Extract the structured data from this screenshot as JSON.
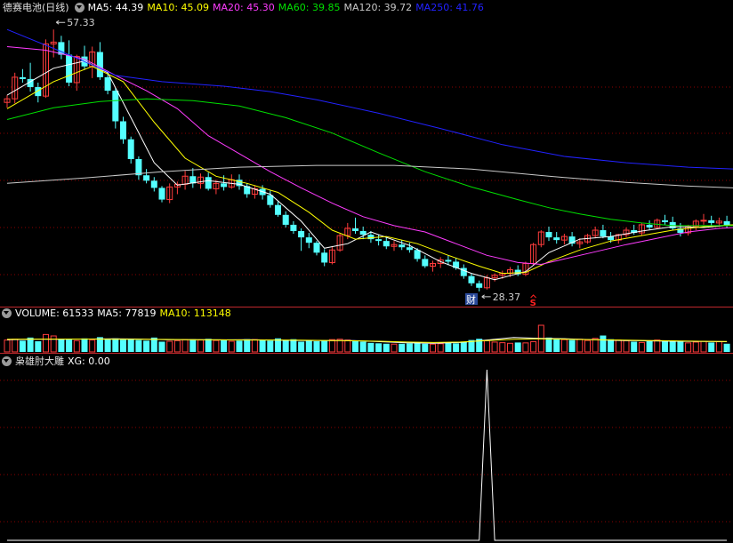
{
  "price_panel": {
    "stock_name": "德赛电池",
    "period": "(日线)",
    "ma_labels": [
      {
        "text": "MA5: 44.39",
        "color": "#ffffff"
      },
      {
        "text": "MA10: 45.09",
        "color": "#ffff00"
      },
      {
        "text": "MA20: 45.30",
        "color": "#ff3cff"
      },
      {
        "text": "MA60: 39.85",
        "color": "#00e000"
      },
      {
        "text": "MA120: 39.72",
        "color": "#c8c8c8"
      },
      {
        "text": "MA250: 41.76",
        "color": "#2222ff"
      }
    ],
    "high_marker": "57.33",
    "low_marker": "28.37",
    "event_badge": "财",
    "signal_mark": "S"
  },
  "volume_panel": {
    "labels": [
      {
        "text": "VOLUME: 61533",
        "color": "#ffffff"
      },
      {
        "text": "MA5: 77819",
        "color": "#ffffff"
      },
      {
        "text": "MA10: 113148",
        "color": "#ffff00"
      }
    ]
  },
  "indicator_panel": {
    "name": "枭雄肘大雕",
    "xg_label": "XG: 0.00"
  },
  "colors": {
    "up": "#ff3c3c",
    "down": "#54ffff",
    "grid": "#8b0000",
    "separator": "#c0282d",
    "background": "#000000"
  },
  "chart_data": {
    "type": "candlestick",
    "y_range": [
      27,
      59
    ],
    "ohlc": [
      [
        49.2,
        50.0,
        48.6,
        49.6
      ],
      [
        49.6,
        52.5,
        49.1,
        52.0
      ],
      [
        52.0,
        52.9,
        51.4,
        51.8
      ],
      [
        51.8,
        53.6,
        50.4,
        50.9
      ],
      [
        50.9,
        51.4,
        49.2,
        49.9
      ],
      [
        49.9,
        56.2,
        49.7,
        55.7
      ],
      [
        55.7,
        57.3,
        54.2,
        55.9
      ],
      [
        55.9,
        56.6,
        54.0,
        54.5
      ],
      [
        54.5,
        56.1,
        51.0,
        51.4
      ],
      [
        51.4,
        54.5,
        50.5,
        54.3
      ],
      [
        54.3,
        55.5,
        52.8,
        53.2
      ],
      [
        53.2,
        55.4,
        51.9,
        54.8
      ],
      [
        54.8,
        55.9,
        51.7,
        52.0
      ],
      [
        52.0,
        52.7,
        50.1,
        50.5
      ],
      [
        50.5,
        50.8,
        46.3,
        47.1
      ],
      [
        47.1,
        47.6,
        44.6,
        45.1
      ],
      [
        45.1,
        45.4,
        42.4,
        42.9
      ],
      [
        42.9,
        43.2,
        40.6,
        41.1
      ],
      [
        41.1,
        41.8,
        40.2,
        40.5
      ],
      [
        40.5,
        40.9,
        39.3,
        39.7
      ],
      [
        39.7,
        39.9,
        38.1,
        38.4
      ],
      [
        38.4,
        40.2,
        38.0,
        39.8
      ],
      [
        39.8,
        40.4,
        39.0,
        40.1
      ],
      [
        40.1,
        41.6,
        39.5,
        41.0
      ],
      [
        41.0,
        41.9,
        39.7,
        40.2
      ],
      [
        40.2,
        41.3,
        39.6,
        40.9
      ],
      [
        40.9,
        41.4,
        39.4,
        39.6
      ],
      [
        39.6,
        40.6,
        39.0,
        40.2
      ],
      [
        40.2,
        41.1,
        39.4,
        39.8
      ],
      [
        39.8,
        41.2,
        39.6,
        40.6
      ],
      [
        40.6,
        41.2,
        39.5,
        39.9
      ],
      [
        39.9,
        40.2,
        38.6,
        39.0
      ],
      [
        39.0,
        40.0,
        38.5,
        39.6
      ],
      [
        39.6,
        40.0,
        38.4,
        38.9
      ],
      [
        38.9,
        39.4,
        37.5,
        37.8
      ],
      [
        37.8,
        38.2,
        36.5,
        36.7
      ],
      [
        36.7,
        37.1,
        35.3,
        35.6
      ],
      [
        35.6,
        36.0,
        34.6,
        34.9
      ],
      [
        34.9,
        35.2,
        32.7,
        34.2
      ],
      [
        34.2,
        34.7,
        33.0,
        33.6
      ],
      [
        33.6,
        33.8,
        32.2,
        32.5
      ],
      [
        32.5,
        32.9,
        31.0,
        31.4
      ],
      [
        31.4,
        33.2,
        31.2,
        32.8
      ],
      [
        32.8,
        34.6,
        32.6,
        34.4
      ],
      [
        34.4,
        35.8,
        34.0,
        35.2
      ],
      [
        35.2,
        36.4,
        34.6,
        34.9
      ],
      [
        34.9,
        35.4,
        34.0,
        34.5
      ],
      [
        34.5,
        34.9,
        33.6,
        34.0
      ],
      [
        34.0,
        34.5,
        33.3,
        33.8
      ],
      [
        33.8,
        34.3,
        32.9,
        33.2
      ],
      [
        33.2,
        33.8,
        32.7,
        33.4
      ],
      [
        33.4,
        33.9,
        32.8,
        33.1
      ],
      [
        33.1,
        33.6,
        32.5,
        32.8
      ],
      [
        32.8,
        33.0,
        31.5,
        31.8
      ],
      [
        31.8,
        32.2,
        30.8,
        31.0
      ],
      [
        31.0,
        31.6,
        30.4,
        31.3
      ],
      [
        31.3,
        32.0,
        30.8,
        31.7
      ],
      [
        31.7,
        32.2,
        31.1,
        31.5
      ],
      [
        31.5,
        31.9,
        30.6,
        30.8
      ],
      [
        30.8,
        31.2,
        29.6,
        29.9
      ],
      [
        29.9,
        30.2,
        28.8,
        29.1
      ],
      [
        29.1,
        29.4,
        28.2,
        28.6
      ],
      [
        28.6,
        30.0,
        28.4,
        29.7
      ],
      [
        29.7,
        30.2,
        29.3,
        30.0
      ],
      [
        30.0,
        30.5,
        29.6,
        30.2
      ],
      [
        30.2,
        30.9,
        29.8,
        30.6
      ],
      [
        30.6,
        31.1,
        29.9,
        30.1
      ],
      [
        30.1,
        31.5,
        29.9,
        31.3
      ],
      [
        31.3,
        33.6,
        31.1,
        33.4
      ],
      [
        33.4,
        35.0,
        33.1,
        34.8
      ],
      [
        34.8,
        35.4,
        33.8,
        34.2
      ],
      [
        34.2,
        34.8,
        33.5,
        33.9
      ],
      [
        33.9,
        34.6,
        33.4,
        34.3
      ],
      [
        34.3,
        34.8,
        33.2,
        33.5
      ],
      [
        33.5,
        34.1,
        33.0,
        33.7
      ],
      [
        33.7,
        34.6,
        33.5,
        34.4
      ],
      [
        34.4,
        35.4,
        34.1,
        35.0
      ],
      [
        35.0,
        35.6,
        34.1,
        34.3
      ],
      [
        34.3,
        34.8,
        33.6,
        33.9
      ],
      [
        33.9,
        34.6,
        33.5,
        34.5
      ],
      [
        34.5,
        35.3,
        34.2,
        35.0
      ],
      [
        35.0,
        35.6,
        34.5,
        34.7
      ],
      [
        34.7,
        35.8,
        34.4,
        35.6
      ],
      [
        35.6,
        36.1,
        35.0,
        35.3
      ],
      [
        35.3,
        36.3,
        35.2,
        36.1
      ],
      [
        36.1,
        36.7,
        35.6,
        35.9
      ],
      [
        35.9,
        36.5,
        35.0,
        35.2
      ],
      [
        35.2,
        35.8,
        34.3,
        34.7
      ],
      [
        34.7,
        35.6,
        34.4,
        35.4
      ],
      [
        35.4,
        36.2,
        35.0,
        36.0
      ],
      [
        36.0,
        36.8,
        35.6,
        36.1
      ],
      [
        36.1,
        36.6,
        35.4,
        35.8
      ],
      [
        35.8,
        36.4,
        35.4,
        36.0
      ],
      [
        36.0,
        36.6,
        35.3,
        35.5
      ]
    ],
    "ma_series": [
      {
        "name": "MA5",
        "color": "#ffffff",
        "points": [
          [
            0,
            50.0
          ],
          [
            6,
            53.0
          ],
          [
            10,
            53.8
          ],
          [
            13,
            52.5
          ],
          [
            16,
            47.5
          ],
          [
            19,
            42.5
          ],
          [
            22,
            40.0
          ],
          [
            26,
            40.5
          ],
          [
            30,
            40.1
          ],
          [
            34,
            39.0
          ],
          [
            38,
            36.0
          ],
          [
            41,
            33.0
          ],
          [
            44,
            33.5
          ],
          [
            47,
            34.8
          ],
          [
            52,
            33.3
          ],
          [
            56,
            31.5
          ],
          [
            60,
            30.2
          ],
          [
            63,
            29.5
          ],
          [
            67,
            30.4
          ],
          [
            70,
            32.5
          ],
          [
            74,
            34.0
          ],
          [
            78,
            34.3
          ],
          [
            82,
            34.9
          ],
          [
            86,
            35.4
          ],
          [
            90,
            35.3
          ],
          [
            94,
            35.6
          ]
        ]
      },
      {
        "name": "MA10",
        "color": "#ffff00",
        "points": [
          [
            0,
            48.5
          ],
          [
            6,
            51.5
          ],
          [
            11,
            53.2
          ],
          [
            15,
            51.5
          ],
          [
            19,
            47.0
          ],
          [
            23,
            43.0
          ],
          [
            27,
            41.0
          ],
          [
            31,
            40.2
          ],
          [
            35,
            39.2
          ],
          [
            39,
            37.0
          ],
          [
            42,
            35.0
          ],
          [
            45,
            34.0
          ],
          [
            49,
            34.3
          ],
          [
            53,
            33.5
          ],
          [
            57,
            32.2
          ],
          [
            61,
            31.0
          ],
          [
            64,
            30.2
          ],
          [
            67,
            30.3
          ],
          [
            70,
            31.5
          ],
          [
            74,
            32.8
          ],
          [
            78,
            33.8
          ],
          [
            82,
            34.4
          ],
          [
            86,
            35.0
          ],
          [
            90,
            35.4
          ],
          [
            94,
            35.6
          ]
        ]
      },
      {
        "name": "MA20",
        "color": "#ff3cff",
        "points": [
          [
            0,
            55.4
          ],
          [
            5,
            55.0
          ],
          [
            10,
            54.0
          ],
          [
            14,
            52.2
          ],
          [
            18,
            50.5
          ],
          [
            22,
            48.5
          ],
          [
            26,
            45.5
          ],
          [
            30,
            43.5
          ],
          [
            34,
            41.5
          ],
          [
            38,
            39.7
          ],
          [
            42,
            38.0
          ],
          [
            46,
            36.5
          ],
          [
            50,
            35.5
          ],
          [
            54,
            34.8
          ],
          [
            58,
            33.5
          ],
          [
            62,
            32.2
          ],
          [
            66,
            31.4
          ],
          [
            69,
            31.2
          ],
          [
            72,
            31.8
          ],
          [
            76,
            32.6
          ],
          [
            80,
            33.4
          ],
          [
            84,
            34.1
          ],
          [
            88,
            34.8
          ],
          [
            92,
            35.2
          ],
          [
            94,
            35.3
          ]
        ]
      },
      {
        "name": "MA60",
        "color": "#00e000",
        "points": [
          [
            0,
            47.3
          ],
          [
            6,
            48.6
          ],
          [
            12,
            49.3
          ],
          [
            18,
            49.6
          ],
          [
            24,
            49.4
          ],
          [
            30,
            48.8
          ],
          [
            36,
            47.5
          ],
          [
            42,
            45.8
          ],
          [
            48,
            43.6
          ],
          [
            54,
            41.5
          ],
          [
            60,
            39.8
          ],
          [
            66,
            38.4
          ],
          [
            70,
            37.5
          ],
          [
            74,
            36.8
          ],
          [
            78,
            36.2
          ],
          [
            82,
            35.8
          ],
          [
            86,
            35.5
          ],
          [
            90,
            35.5
          ],
          [
            94,
            35.5
          ]
        ]
      },
      {
        "name": "MA120",
        "color": "#c8c8c8",
        "points": [
          [
            0,
            40.2
          ],
          [
            10,
            40.8
          ],
          [
            20,
            41.5
          ],
          [
            30,
            42.0
          ],
          [
            40,
            42.2
          ],
          [
            50,
            42.2
          ],
          [
            60,
            41.8
          ],
          [
            70,
            41.0
          ],
          [
            80,
            40.3
          ],
          [
            88,
            39.9
          ],
          [
            94,
            39.7
          ]
        ]
      },
      {
        "name": "MA250",
        "color": "#2222ff",
        "points": [
          [
            0,
            57.3
          ],
          [
            8,
            54.5
          ],
          [
            14,
            52.2
          ],
          [
            20,
            51.5
          ],
          [
            28,
            51.0
          ],
          [
            34,
            50.4
          ],
          [
            40,
            49.5
          ],
          [
            48,
            48.0
          ],
          [
            56,
            46.3
          ],
          [
            64,
            44.5
          ],
          [
            72,
            43.2
          ],
          [
            80,
            42.5
          ],
          [
            88,
            42.0
          ],
          [
            94,
            41.8
          ]
        ]
      }
    ],
    "volume": {
      "y_range": [
        0,
        1.3
      ],
      "values": [
        0.58,
        0.62,
        0.55,
        0.7,
        0.52,
        0.85,
        0.78,
        0.64,
        0.6,
        0.55,
        0.66,
        0.58,
        0.72,
        0.62,
        0.66,
        0.6,
        0.62,
        0.58,
        0.55,
        0.7,
        0.5,
        0.52,
        0.55,
        0.6,
        0.62,
        0.58,
        0.64,
        0.56,
        0.6,
        0.52,
        0.55,
        0.62,
        0.6,
        0.58,
        0.55,
        0.66,
        0.58,
        0.62,
        0.5,
        0.55,
        0.52,
        0.56,
        0.6,
        0.62,
        0.58,
        0.56,
        0.5,
        0.44,
        0.42,
        0.4,
        0.38,
        0.4,
        0.42,
        0.44,
        0.4,
        0.38,
        0.4,
        0.45,
        0.42,
        0.5,
        0.58,
        0.64,
        0.55,
        0.48,
        0.45,
        0.42,
        0.46,
        0.44,
        0.5,
        1.3,
        0.7,
        0.62,
        0.6,
        0.58,
        0.62,
        0.56,
        0.66,
        0.8,
        0.62,
        0.58,
        0.55,
        0.5,
        0.46,
        0.52,
        0.58,
        0.56,
        0.54,
        0.5,
        0.44,
        0.48,
        0.52,
        0.46,
        0.5,
        0.4
      ],
      "ma_series": [
        {
          "name": "MA5",
          "color": "#ffffff",
          "values": [
            0.6,
            0.62,
            0.62,
            0.63,
            0.64,
            0.63,
            0.6,
            0.6,
            0.59,
            0.6,
            0.58,
            0.56,
            0.55,
            0.55,
            0.5,
            0.44,
            0.42,
            0.46,
            0.58,
            0.7,
            0.66,
            0.64,
            0.6,
            0.56,
            0.54,
            0.52,
            0.51,
            0.5
          ]
        },
        {
          "name": "MA10",
          "color": "#ffff00",
          "values": [
            0.62,
            0.63,
            0.63,
            0.63,
            0.62,
            0.62,
            0.61,
            0.6,
            0.59,
            0.58,
            0.58,
            0.57,
            0.56,
            0.54,
            0.52,
            0.48,
            0.46,
            0.48,
            0.55,
            0.62,
            0.64,
            0.62,
            0.6,
            0.58,
            0.56,
            0.54,
            0.52,
            0.51
          ]
        }
      ]
    },
    "xg": {
      "type": "line",
      "y_range": [
        0,
        1
      ],
      "values": [
        0,
        0,
        0,
        0,
        0,
        0,
        0,
        0,
        0,
        0,
        0,
        0,
        0,
        0,
        0,
        0,
        0,
        0,
        0,
        0,
        0,
        0,
        0,
        0,
        0,
        0,
        0,
        0,
        0,
        0,
        0,
        0,
        0,
        0,
        0,
        0,
        0,
        0,
        0,
        0,
        0,
        0,
        0,
        0,
        0,
        0,
        0,
        0,
        0,
        0,
        0,
        0,
        0,
        0,
        0,
        0,
        0,
        0,
        0,
        0,
        0,
        0,
        1,
        0,
        0,
        0,
        0,
        0,
        0,
        0,
        0,
        0,
        0,
        0,
        0,
        0,
        0,
        0,
        0,
        0,
        0,
        0,
        0,
        0,
        0,
        0,
        0,
        0,
        0,
        0,
        0,
        0,
        0,
        0
      ]
    }
  }
}
